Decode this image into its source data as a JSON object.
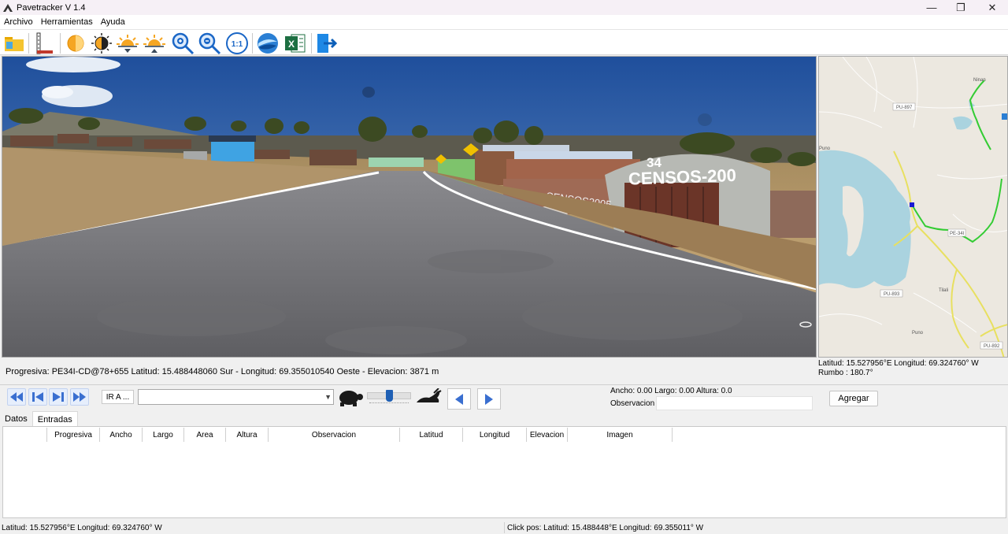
{
  "window": {
    "title": "Pavetracker V 1.4",
    "minimize": "—",
    "maximize": "❐",
    "close": "✕"
  },
  "menu": [
    "Archivo",
    "Herramientas",
    "Ayuda"
  ],
  "toolbar": {
    "icons": [
      "open-folder-icon",
      "measure-icon",
      "brightness-icon",
      "contrast-icon",
      "sunrise-down-icon",
      "sunrise-up-icon",
      "zoom-in-icon",
      "zoom-out-icon",
      "zoom-reset-icon",
      "google-earth-icon",
      "excel-icon",
      "exit-icon"
    ],
    "zoom_reset_label": "1:1"
  },
  "road_view": {
    "wall_text": "CENSOS-200",
    "wall_number": "34",
    "wall_text_lower": "CENSOS2005"
  },
  "map": {
    "labels": [
      "PU-897",
      "Ninan",
      "Puno",
      "PE-34I",
      "PU-893",
      "Tilali",
      "Puno",
      "PU-892"
    ],
    "route_color": "#33cc33",
    "road_color": "#e8e060",
    "water_color": "#aad3df"
  },
  "info": {
    "progresiva": "Progresiva: PE34I-CD@78+655 Latitud: 15.488448060 Sur - Longitud: 69.355010540 Oeste - Elevacion: 3871 m",
    "map_lat_lon": "Latitud: 15.527956°E Longitud: 69.324760° W",
    "rumbo": "Rumbo : 180.7°"
  },
  "controls": {
    "ir_a_label": "IR A ...",
    "combo_value": "",
    "speed_fraction": 0.5,
    "dims": "Ancho:  0.00 Largo:  0.00 Altura: 0.0",
    "obs_label": "Observacion",
    "obs_value": "",
    "agregar_label": "Agregar"
  },
  "tabs": [
    "Datos",
    "Entradas"
  ],
  "table": {
    "columns": [
      "",
      "Progresiva",
      "Ancho",
      "Largo",
      "Area",
      "Altura",
      "Observacion",
      "Latitud",
      "Longitud",
      "Elevacion",
      "Imagen"
    ],
    "rows": []
  },
  "status": {
    "left": "Latitud: 15.527956°E Longitud: 69.324760° W",
    "right": "Click pos: Latitud: 15.488448°E Longitud: 69.355011° W"
  }
}
